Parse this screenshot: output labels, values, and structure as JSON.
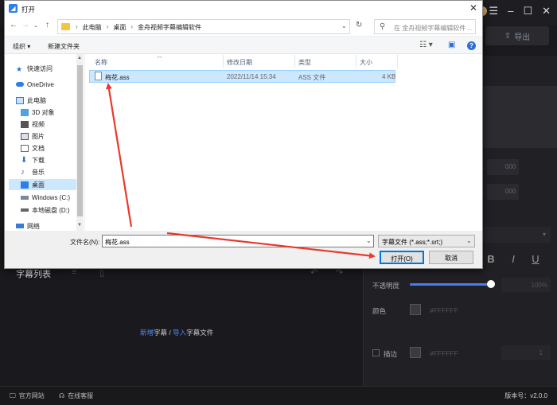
{
  "app": {
    "export_label": "导出",
    "subtitle_list_label": "字幕列表",
    "empty_hint": {
      "new": "新增",
      "word1": "字幕",
      "slash": " / ",
      "import": "导入",
      "word2": "字幕文件"
    },
    "time_value_1": "000",
    "time_value_2": "000",
    "opacity_label": "不透明度",
    "opacity_percent": "100%",
    "opacity_value": 1.0,
    "color_label": "颜色",
    "color_hex": "#FFFFFF",
    "stroke_label": "描边",
    "stroke_hex": "#FFFFFF",
    "stroke_width": "1",
    "bold_label": "B",
    "italic_label": "I",
    "underline_label": "U",
    "official_site": "官方网站",
    "online_support": "在线客服",
    "version": "版本号：v2.0.0",
    "accent_color": "#4a7cf0"
  },
  "dialog": {
    "title": "打开",
    "breadcrumbs": [
      "此电脑",
      "桌面",
      "金舟视频字幕编辑软件"
    ],
    "search_placeholder": "在 金舟视频字幕编辑软件 ...",
    "toolbar": {
      "organize": "组织 ▾",
      "new_folder": "新建文件夹"
    },
    "nav_items": [
      {
        "label": "快速访问",
        "icon": "star-icon"
      },
      {
        "label": "OneDrive",
        "icon": "cloud-icon"
      },
      {
        "label": "此电脑",
        "icon": "computer-icon"
      },
      {
        "label": "3D 对象",
        "icon": "cube-icon"
      },
      {
        "label": "视频",
        "icon": "video-icon"
      },
      {
        "label": "图片",
        "icon": "picture-icon"
      },
      {
        "label": "文档",
        "icon": "document-icon"
      },
      {
        "label": "下载",
        "icon": "download-icon"
      },
      {
        "label": "音乐",
        "icon": "music-icon"
      },
      {
        "label": "桌面",
        "icon": "desktop-icon"
      },
      {
        "label": "Windows (C:)",
        "icon": "drive-icon"
      },
      {
        "label": "本地磁盘 (D:)",
        "icon": "drive-icon"
      },
      {
        "label": "网络",
        "icon": "network-icon"
      }
    ],
    "columns": {
      "name": "名称",
      "modified": "修改日期",
      "type": "类型",
      "size": "大小"
    },
    "files": [
      {
        "name": "梅花.ass",
        "modified": "2022/11/14 15:34",
        "type": "ASS 文件",
        "size": "4 KB"
      }
    ],
    "filename_label": "文件名(N):",
    "filename_value": "梅花.ass",
    "filetype_value": "字幕文件 (*.ass;*.srt;)",
    "open_button": "打开(O)",
    "cancel_button": "取消"
  }
}
